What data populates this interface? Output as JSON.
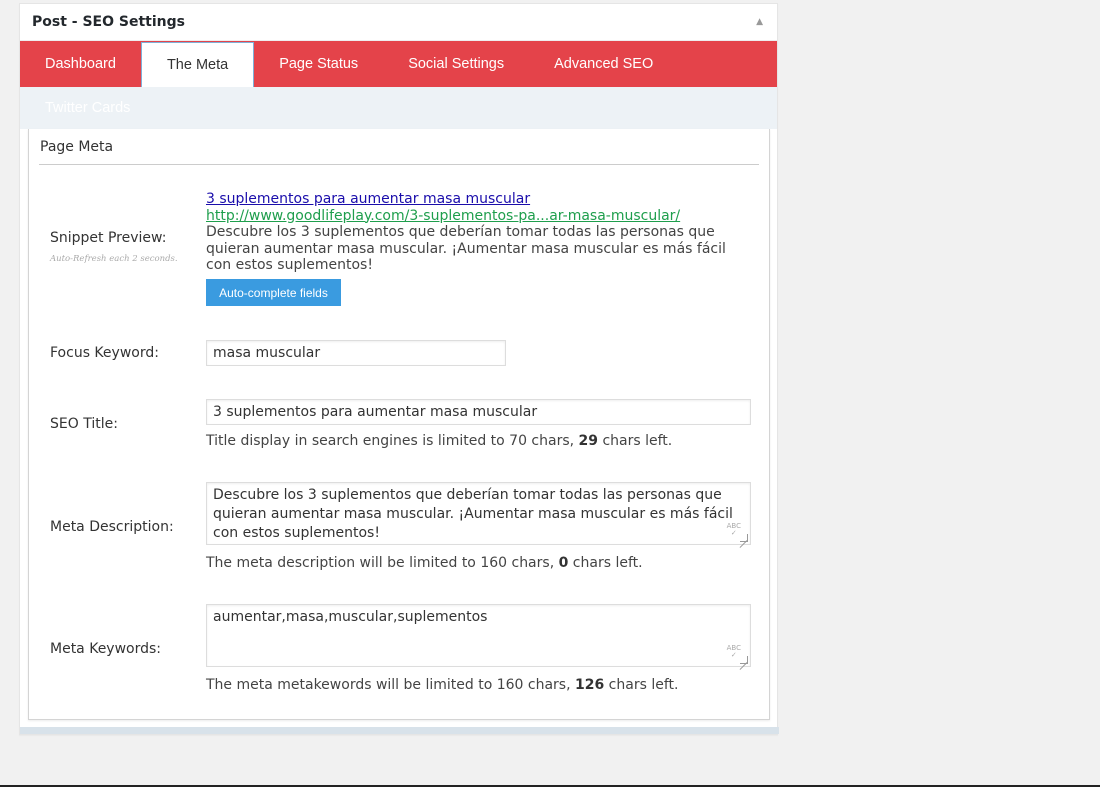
{
  "metabox": {
    "title": "Post - SEO Settings",
    "toggle_icon": "triangle-up-icon"
  },
  "tabs": [
    {
      "label": "Dashboard",
      "active": false
    },
    {
      "label": "The Meta",
      "active": true
    },
    {
      "label": "Page Status",
      "active": false
    },
    {
      "label": "Social Settings",
      "active": false
    },
    {
      "label": "Advanced SEO",
      "active": false
    }
  ],
  "subtabs": [
    {
      "label": "Twitter Cards"
    }
  ],
  "panel": {
    "title": "Page Meta",
    "snippet": {
      "label": "Snippet Preview:",
      "sublabel": "Auto-Refresh each 2 seconds.",
      "title": "3 suplementos para aumentar masa muscular",
      "url": "http://www.goodlifeplay.com/3-suplementos-pa...ar-masa-muscular/",
      "description": "Descubre los 3 suplementos que deberían tomar todas las personas que quieran aumentar masa muscular. ¡Aumentar masa muscular es más fácil con estos suplementos!",
      "button": "Auto-complete fields"
    },
    "focus_keyword": {
      "label": "Focus Keyword:",
      "value": "masa muscular"
    },
    "seo_title": {
      "label": "SEO Title:",
      "value": "3 suplementos para aumentar masa muscular",
      "help_prefix": "Title display in search engines is limited to 70 chars, ",
      "help_count": "29",
      "help_suffix": " chars left."
    },
    "meta_description": {
      "label": "Meta Description:",
      "value": "Descubre los 3 suplementos que deberían tomar todas las personas que quieran aumentar masa muscular. ¡Aumentar masa muscular es más fácil con estos suplementos!",
      "help_prefix": "The meta description will be limited to 160 chars, ",
      "help_count": "0",
      "help_suffix": " chars left."
    },
    "meta_keywords": {
      "label": "Meta Keywords:",
      "value": "aumentar,masa,muscular,suplementos",
      "help_prefix": "The meta metakewords will be limited to 160 chars, ",
      "help_count": "126",
      "help_suffix": " chars left."
    }
  },
  "colors": {
    "tab_bar": "#e4434a",
    "button": "#3a9be0",
    "link": "#1a0dab",
    "url": "#1e9e4c"
  }
}
